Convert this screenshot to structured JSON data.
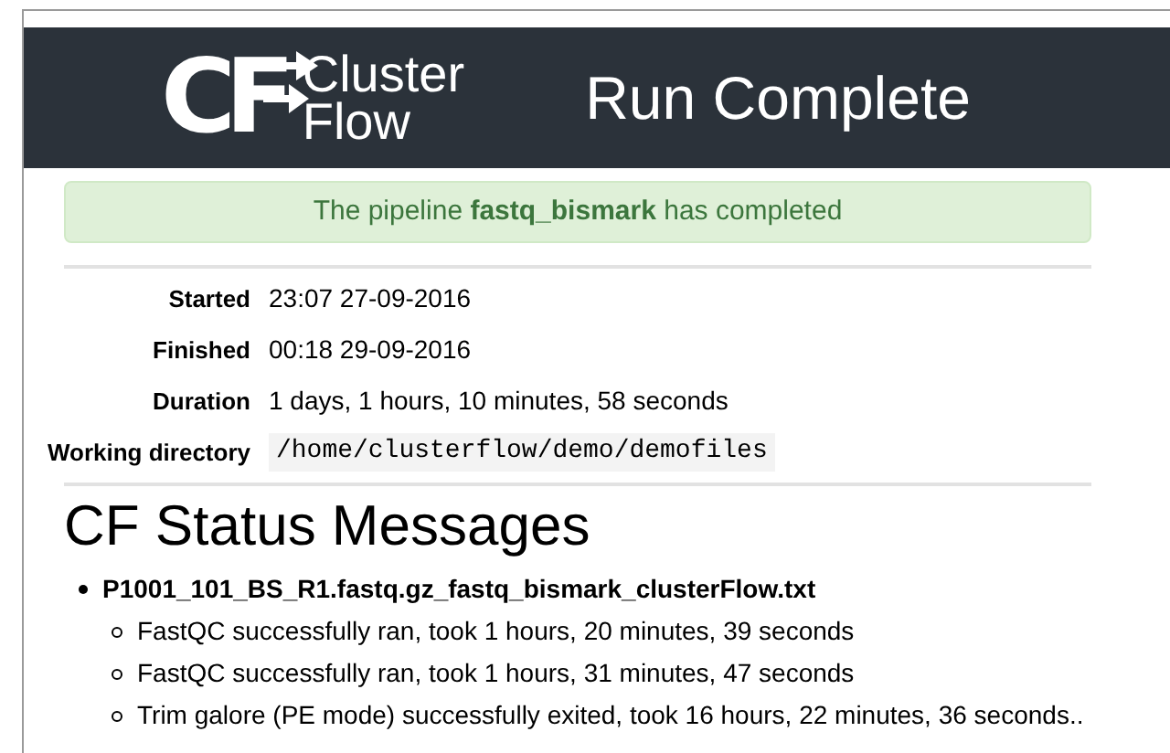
{
  "header": {
    "logo_mark": "CF",
    "logo_words": [
      "Cluster",
      "Flow"
    ],
    "title": "Run Complete"
  },
  "alert": {
    "text": "The pipeline **fastq_bismark** has completed"
  },
  "details": [
    {
      "label": "Started",
      "value": "23:07 27-09-2016",
      "kind": "text"
    },
    {
      "label": "Finished",
      "value": "00:18 29-09-2016",
      "kind": "text"
    },
    {
      "label": "Duration",
      "value": "1 days, 1 hours, 10 minutes, 58 seconds",
      "kind": "text"
    },
    {
      "label": "Working directory",
      "value": "/home/clusterflow/demo/demofiles",
      "kind": "code"
    }
  ],
  "status": {
    "heading": "CF Status Messages",
    "files": [
      {
        "name": "P1001_101_BS_R1.fastq.gz_fastq_bismark_clusterFlow.txt",
        "messages": [
          "FastQC successfully ran, took 1 hours, 20 minutes, 39 seconds",
          "FastQC successfully ran, took 1 hours, 31 minutes, 47 seconds",
          "Trim galore (PE mode) successfully exited, took 16 hours, 22 minutes, 36 seconds.."
        ]
      }
    ]
  }
}
